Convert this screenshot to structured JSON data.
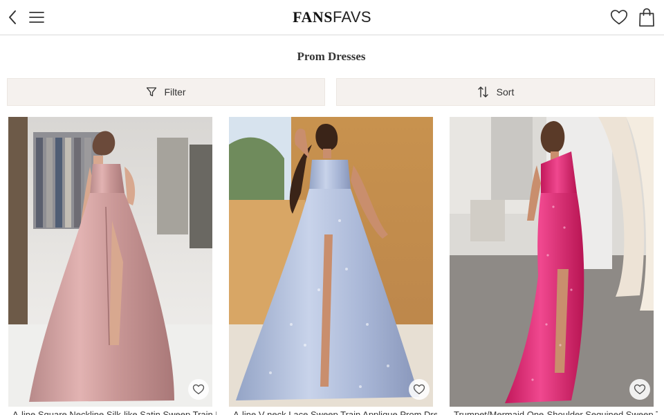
{
  "header": {
    "logo_part1": "FANS",
    "logo_part2": "FAVS",
    "icons": [
      "back-arrow-icon",
      "hamburger-menu-icon",
      "heart-icon",
      "shopping-bag-icon"
    ]
  },
  "page": {
    "title": "Prom Dresses"
  },
  "toolbar": {
    "filter_label": "Filter",
    "sort_label": "Sort"
  },
  "products": [
    {
      "name": "A-line Square Neckline Silk-like Satin Sweep Train Prom Dress",
      "image": "pink satin gown"
    },
    {
      "name": "A-line V-neck Lace Sweep Train Applique Prom Dress",
      "image": "light blue lace gown"
    },
    {
      "name": "Trumpet/Mermaid One-Shoulder Sequined Sweep Train Prom Dress",
      "image": "fuchsia sequin gown"
    }
  ],
  "colors": {
    "toolbar_bg": "#f5f1ee",
    "border": "#d9d9d9",
    "text": "#333333"
  }
}
